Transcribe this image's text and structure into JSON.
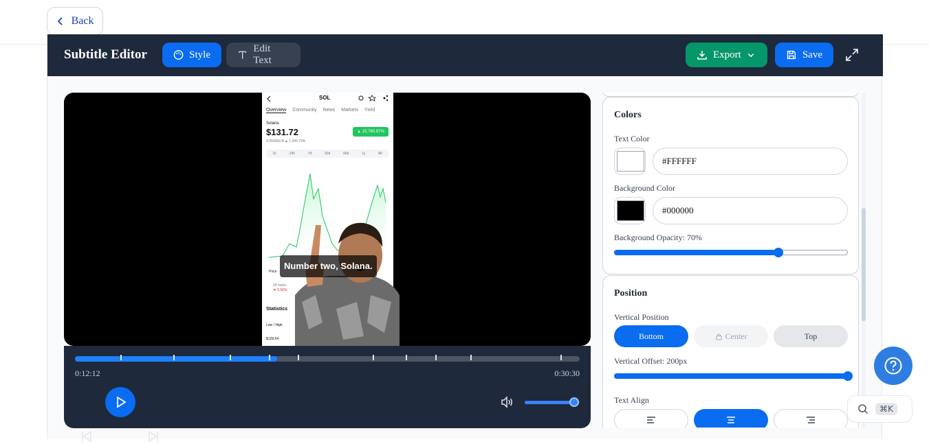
{
  "topbar": {
    "back_label": "Back"
  },
  "header": {
    "title": "Subtitle Editor",
    "tabs": [
      {
        "label": "Style",
        "active": true
      },
      {
        "label": "Edit Text",
        "active": false
      }
    ],
    "export_label": "Export",
    "save_label": "Save"
  },
  "video": {
    "subtitle_text": "Number two, Solana.",
    "phone": {
      "symbol": "SOL",
      "tabs": [
        "Overview",
        "Community",
        "News",
        "Markets",
        "Yield"
      ],
      "name": "Solana",
      "price": "$131.72",
      "change_badge": "▲ 15,760.97%",
      "sub_line": "0.002064 B  ▲ 1,306.73%",
      "ranges": [
        "1h",
        "24h",
        "7d",
        "30d",
        "90d",
        "1y",
        "All"
      ],
      "price_label": "Price",
      "period_label": "24 hours",
      "period_change": "▼ 5.56%",
      "stats_label": "Statistics",
      "lowhigh_label": "Low / High",
      "low_value": "$128.64"
    }
  },
  "player": {
    "current_time": "0:12:12",
    "total_time": "0:30:30",
    "progress": 0.4,
    "volume": 0.9
  },
  "panel": {
    "colors": {
      "heading": "Colors",
      "text_color_label": "Text Color",
      "text_color": "#FFFFFF",
      "bg_color_label": "Background Color",
      "bg_color": "#000000",
      "opacity_label": "Background Opacity: 70%",
      "opacity": 0.7
    },
    "position": {
      "heading": "Position",
      "vertical_label": "Vertical Position",
      "options": [
        "Bottom",
        "Center",
        "Top"
      ],
      "selected": "Bottom",
      "offset_label": "Vertical Offset: 200px",
      "offset": 1.0,
      "align_label": "Text Align",
      "align_selected": "center"
    }
  },
  "floating": {
    "shortcut": "⌘K"
  },
  "colors": {
    "primary": "#0a6cf0",
    "export_green": "#059669",
    "header_bg": "#1e293b"
  }
}
